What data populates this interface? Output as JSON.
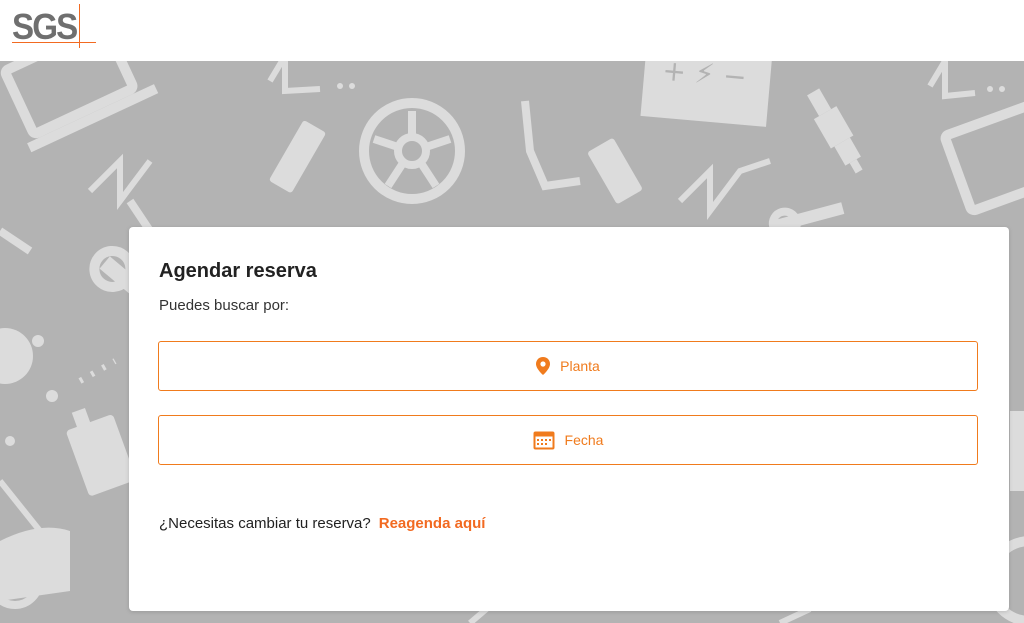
{
  "header": {
    "logo_text": "SGS",
    "logo_accent_color": "#f26a21"
  },
  "background": {
    "color": "#b3b3b3",
    "icon_color": "#dcdcdc",
    "motif": [
      "laptop-icon",
      "tire-icon",
      "battery-icon",
      "spark-plug-icon",
      "wrench-icon",
      "spring-icon",
      "car-icon",
      "oil-can-icon"
    ]
  },
  "card": {
    "title": "Agendar reserva",
    "subtitle": "Puedes buscar por:",
    "options": [
      {
        "label": "Planta",
        "icon": "location-pin-icon"
      },
      {
        "label": "Fecha",
        "icon": "calendar-icon"
      }
    ],
    "change_question": "¿Necesitas cambiar tu reserva?",
    "change_link": "Reagenda aquí"
  },
  "colors": {
    "accent": "#f07b1d",
    "text": "#222222"
  }
}
